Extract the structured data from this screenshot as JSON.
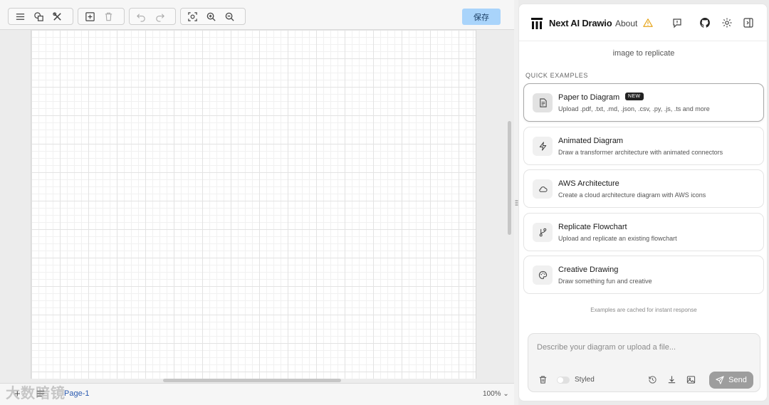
{
  "toolbar": {
    "save_label": "保存"
  },
  "status": {
    "page_tab": "Page-1",
    "zoom": "100%",
    "zoom_chevron": "⌄",
    "add_page": "+",
    "watermark": "大数暗镜"
  },
  "header": {
    "title": "Next AI Drawio",
    "about": "About"
  },
  "panel": {
    "hint_text": "image to replicate",
    "section_label": "QUICK EXAMPLES",
    "cache_note": "Examples are cached for instant response",
    "examples": [
      {
        "title": "Paper to Diagram",
        "badge": "NEW",
        "desc": "Upload .pdf, .txt, .md, .json, .csv, .py, .js, .ts and more",
        "icon": "file-text-icon"
      },
      {
        "title": "Animated Diagram",
        "desc": "Draw a transformer architecture with animated connectors",
        "icon": "zap-icon"
      },
      {
        "title": "AWS Architecture",
        "desc": "Create a cloud architecture diagram with AWS icons",
        "icon": "cloud-icon"
      },
      {
        "title": "Replicate Flowchart",
        "desc": "Upload and replicate an existing flowchart",
        "icon": "git-branch-icon"
      },
      {
        "title": "Creative Drawing",
        "desc": "Draw something fun and creative",
        "icon": "palette-icon"
      }
    ]
  },
  "composer": {
    "placeholder": "Describe your diagram or upload a file...",
    "styled_label": "Styled",
    "send_label": "Send"
  },
  "colors": {
    "save_bg": "#a9d4fb",
    "send_bg": "#9d9d9d",
    "warn": "#e6a317",
    "badge_bg": "#222222"
  }
}
